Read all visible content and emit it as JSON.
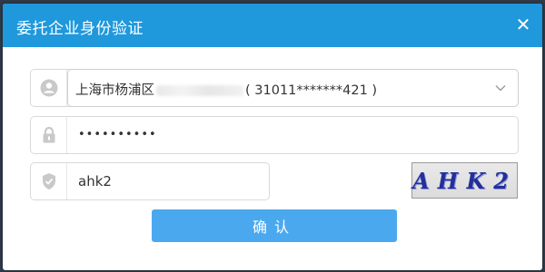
{
  "dialog": {
    "title": "委托企业身份验证",
    "close_glyph": "✕"
  },
  "company_select": {
    "prefix": "上海市杨浦区",
    "suffix": "( 31011*******421 )",
    "icon": "user-icon"
  },
  "password": {
    "value": "••••••••••",
    "icon": "lock-icon"
  },
  "captcha_input": {
    "value": "ahk2",
    "icon": "shield-icon"
  },
  "captcha_image": {
    "text": "AHK2"
  },
  "confirm_button": {
    "label": "确认"
  },
  "colors": {
    "titlebar": "#1f98dc",
    "button": "#4aa8ef"
  }
}
